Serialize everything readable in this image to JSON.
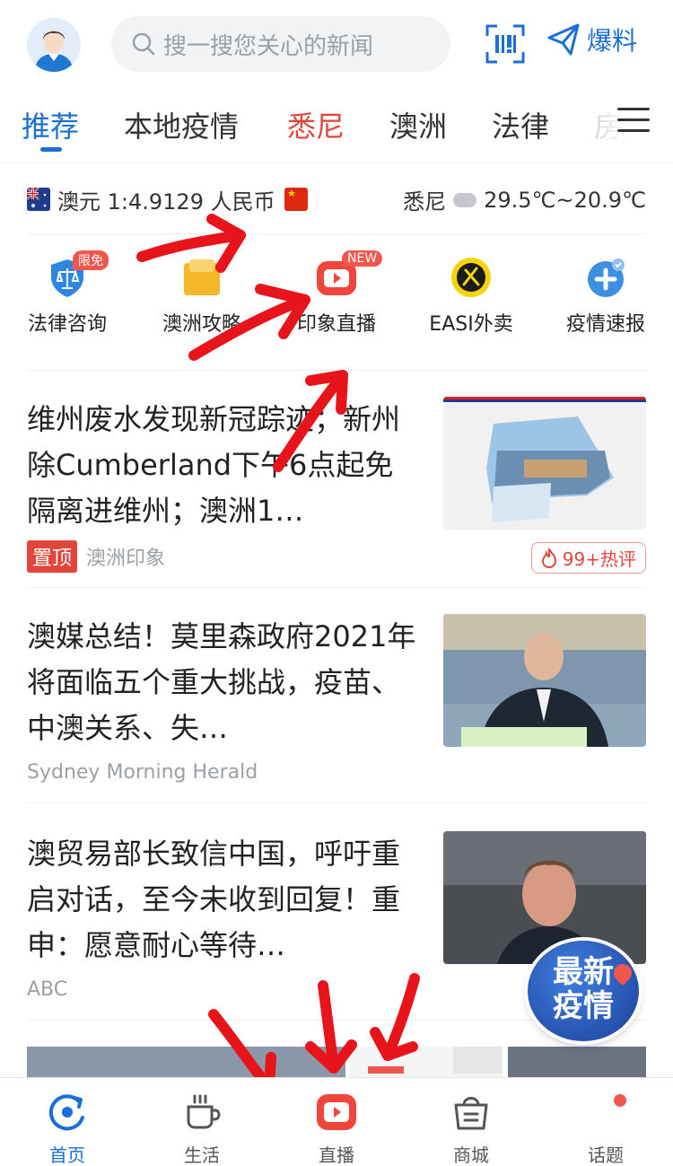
{
  "header": {
    "search_placeholder": "搜一搜您关心的新闻",
    "baoliao_label": "爆料"
  },
  "tabs": [
    {
      "label": "推荐"
    },
    {
      "label": "本地疫情"
    },
    {
      "label": "悉尼"
    },
    {
      "label": "澳洲"
    },
    {
      "label": "法律"
    },
    {
      "label": "房产"
    }
  ],
  "info": {
    "rate": "澳元 1:4.9129 人民币",
    "city": "悉尼",
    "temperature": "29.5℃~20.9℃"
  },
  "quick_links": [
    {
      "label": "法律咨询",
      "badge": "限免"
    },
    {
      "label": "澳洲攻略",
      "badge": ""
    },
    {
      "label": "印象直播",
      "badge": "NEW"
    },
    {
      "label": "EASI外卖",
      "badge": ""
    },
    {
      "label": "疫情速报",
      "badge": ""
    }
  ],
  "news": [
    {
      "title": "维州废水发现新冠踪迹；新州除Cumberland下午6点起免隔离进维州；澳洲1…",
      "pinned_label": "置顶",
      "source": "澳洲印象",
      "comments": "99+热评"
    },
    {
      "title": "澳媒总结！莫里森政府2021年将面临五个重大挑战，疫苗、中澳关系、失…",
      "source": "Sydney Morning Herald"
    },
    {
      "title": "澳贸易部长致信中国，呼吁重启对话，至今未收到回复！重申：愿意耐心等待…",
      "source": "ABC"
    }
  ],
  "covid_badge": {
    "line1": "最新",
    "line2": "疫情"
  },
  "bottom_nav": [
    {
      "label": "首页",
      "active": true
    },
    {
      "label": "生活"
    },
    {
      "label": "直播"
    },
    {
      "label": "商城"
    },
    {
      "label": "话题"
    }
  ],
  "colors": {
    "accent": "#1a6fd6",
    "highlight": "#e2453b",
    "annotation_arrow": "#e8141c"
  }
}
